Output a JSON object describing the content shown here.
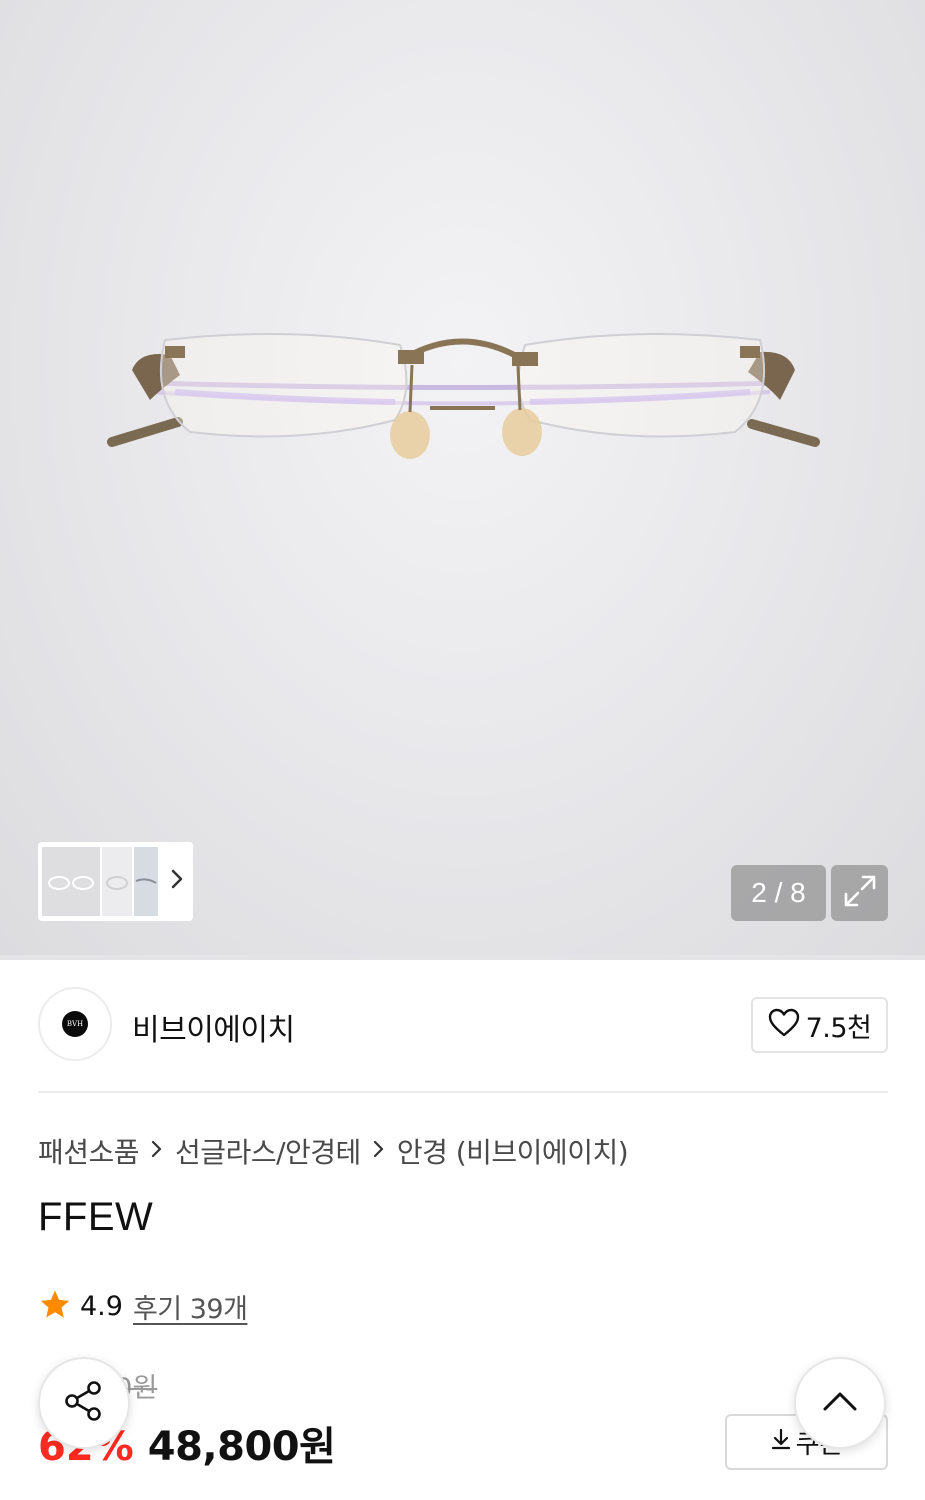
{
  "gallery": {
    "page_indicator": "2 / 8",
    "current_page": 2,
    "total_pages": 8
  },
  "brand": {
    "name": "비브이에이치",
    "logo_text": "BVH",
    "like_count": "7.5천"
  },
  "breadcrumb": {
    "items": [
      "패션소품",
      "선글라스/안경테",
      "안경 (비브이에이치)"
    ]
  },
  "product": {
    "title": "FFEW",
    "rating": "4.9",
    "review_link": "후기 39개",
    "original_price": "00원",
    "discount": "62%",
    "sale_price": "48,800원"
  },
  "coupon": {
    "label": "쿠폰"
  },
  "colors": {
    "discount_red": "#ff2a21",
    "star_orange": "#ff8a00"
  },
  "icons": {
    "expand": "expand-icon",
    "heart": "heart-icon",
    "star": "star-icon",
    "share": "share-icon",
    "scroll_top": "chevron-up-icon",
    "download": "download-icon",
    "thumb_next": "chevron-right-icon"
  }
}
